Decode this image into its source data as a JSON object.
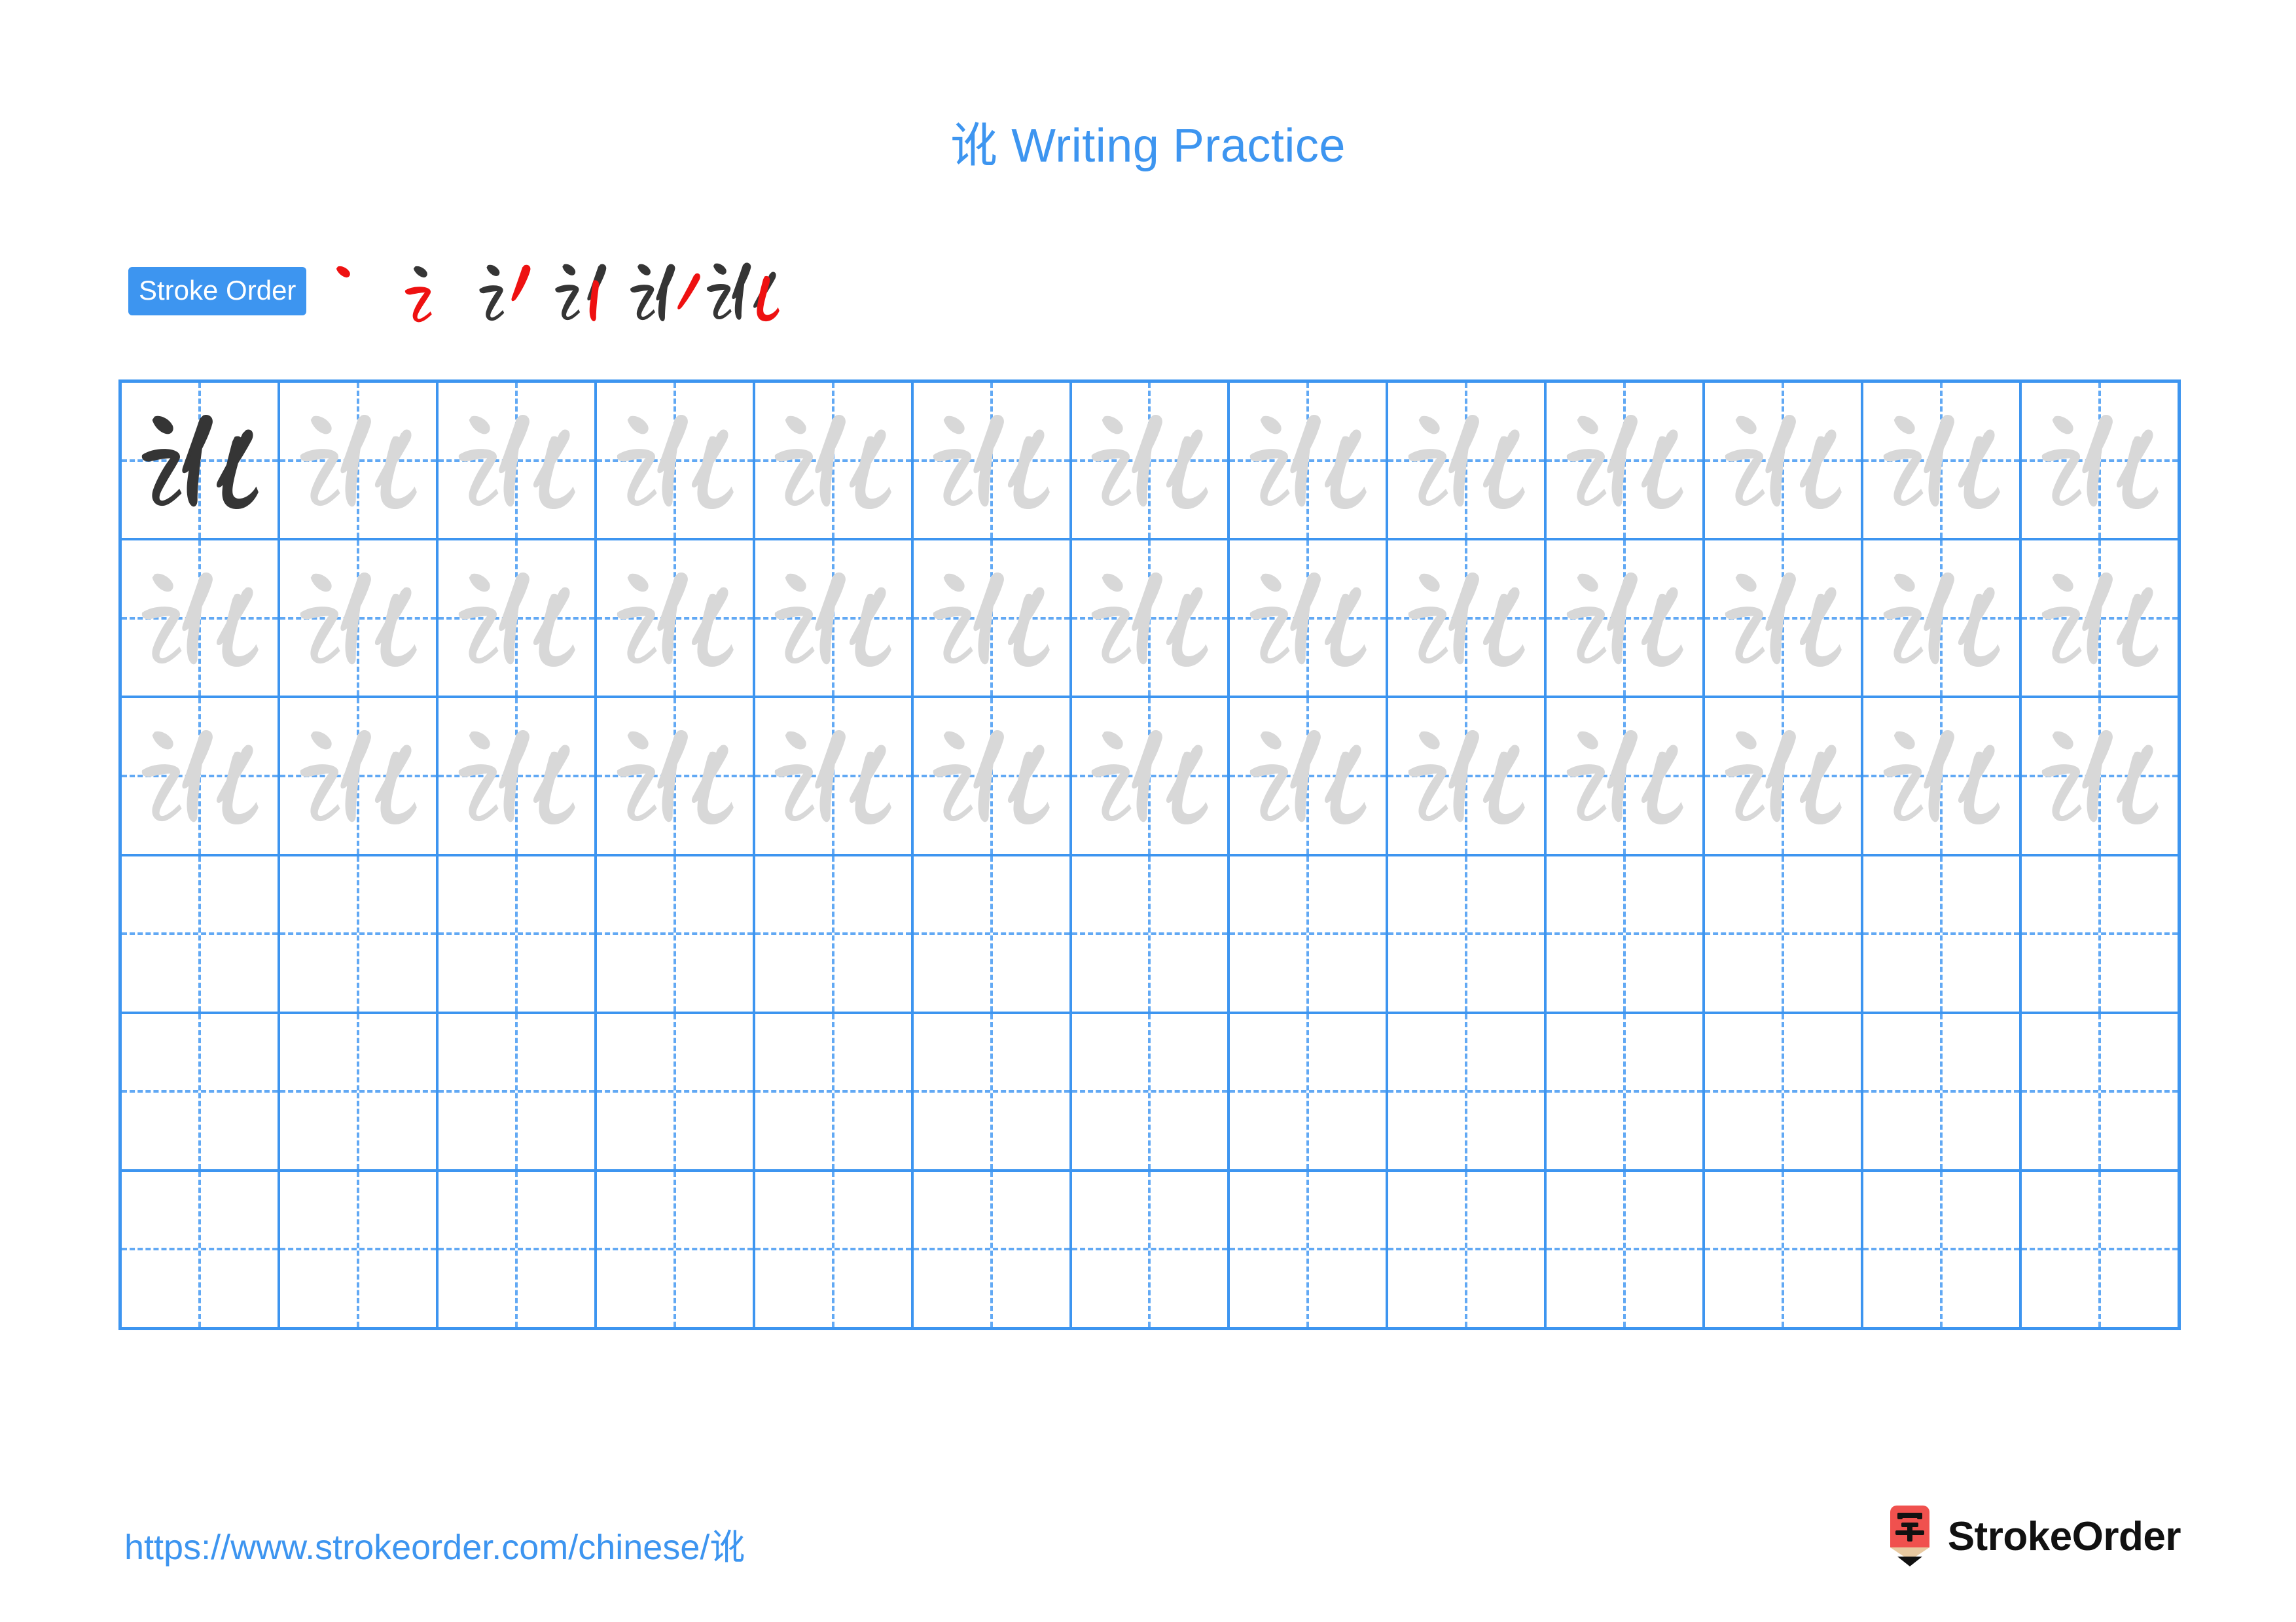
{
  "character": "讹",
  "title": "讹 Writing Practice",
  "stroke_order": {
    "badge_label": "Stroke Order",
    "stroke_count": 6,
    "new_stroke_color": "#ee1111",
    "prev_stroke_color": "#353535",
    "steps": [
      {
        "index": 1,
        "name": "stroke-step-1",
        "strokes_shown": 1
      },
      {
        "index": 2,
        "name": "stroke-step-2",
        "strokes_shown": 2
      },
      {
        "index": 3,
        "name": "stroke-step-3",
        "strokes_shown": 3
      },
      {
        "index": 4,
        "name": "stroke-step-4",
        "strokes_shown": 4
      },
      {
        "index": 5,
        "name": "stroke-step-5",
        "strokes_shown": 5
      },
      {
        "index": 6,
        "name": "stroke-step-6",
        "strokes_shown": 6
      }
    ]
  },
  "grid": {
    "columns": 13,
    "rows": 6,
    "line_color": "#3d95f0",
    "guide_color": "#62a9f4",
    "dark_char_color": "#353535",
    "light_char_color": "#d8d8d8",
    "row_fill": [
      [
        "dark",
        "light",
        "light",
        "light",
        "light",
        "light",
        "light",
        "light",
        "light",
        "light",
        "light",
        "light",
        "light"
      ],
      [
        "light",
        "light",
        "light",
        "light",
        "light",
        "light",
        "light",
        "light",
        "light",
        "light",
        "light",
        "light",
        "light"
      ],
      [
        "light",
        "light",
        "light",
        "light",
        "light",
        "light",
        "light",
        "light",
        "light",
        "light",
        "light",
        "light",
        "light"
      ],
      [
        "empty",
        "empty",
        "empty",
        "empty",
        "empty",
        "empty",
        "empty",
        "empty",
        "empty",
        "empty",
        "empty",
        "empty",
        "empty"
      ],
      [
        "empty",
        "empty",
        "empty",
        "empty",
        "empty",
        "empty",
        "empty",
        "empty",
        "empty",
        "empty",
        "empty",
        "empty",
        "empty"
      ],
      [
        "empty",
        "empty",
        "empty",
        "empty",
        "empty",
        "empty",
        "empty",
        "empty",
        "empty",
        "empty",
        "empty",
        "empty",
        "empty"
      ]
    ]
  },
  "footer": {
    "url": "https://www.strokeorder.com/chinese/讹",
    "brand_name": "StrokeOrder",
    "logo_glyph": "字",
    "logo_color": "#f0514e",
    "logo_tip_color": "#e8c9a0"
  },
  "colors": {
    "accent": "#3d95f0",
    "title": "#3d95f0",
    "red": "#ee1111",
    "ink": "#353535",
    "ghost": "#d8d8d8"
  }
}
